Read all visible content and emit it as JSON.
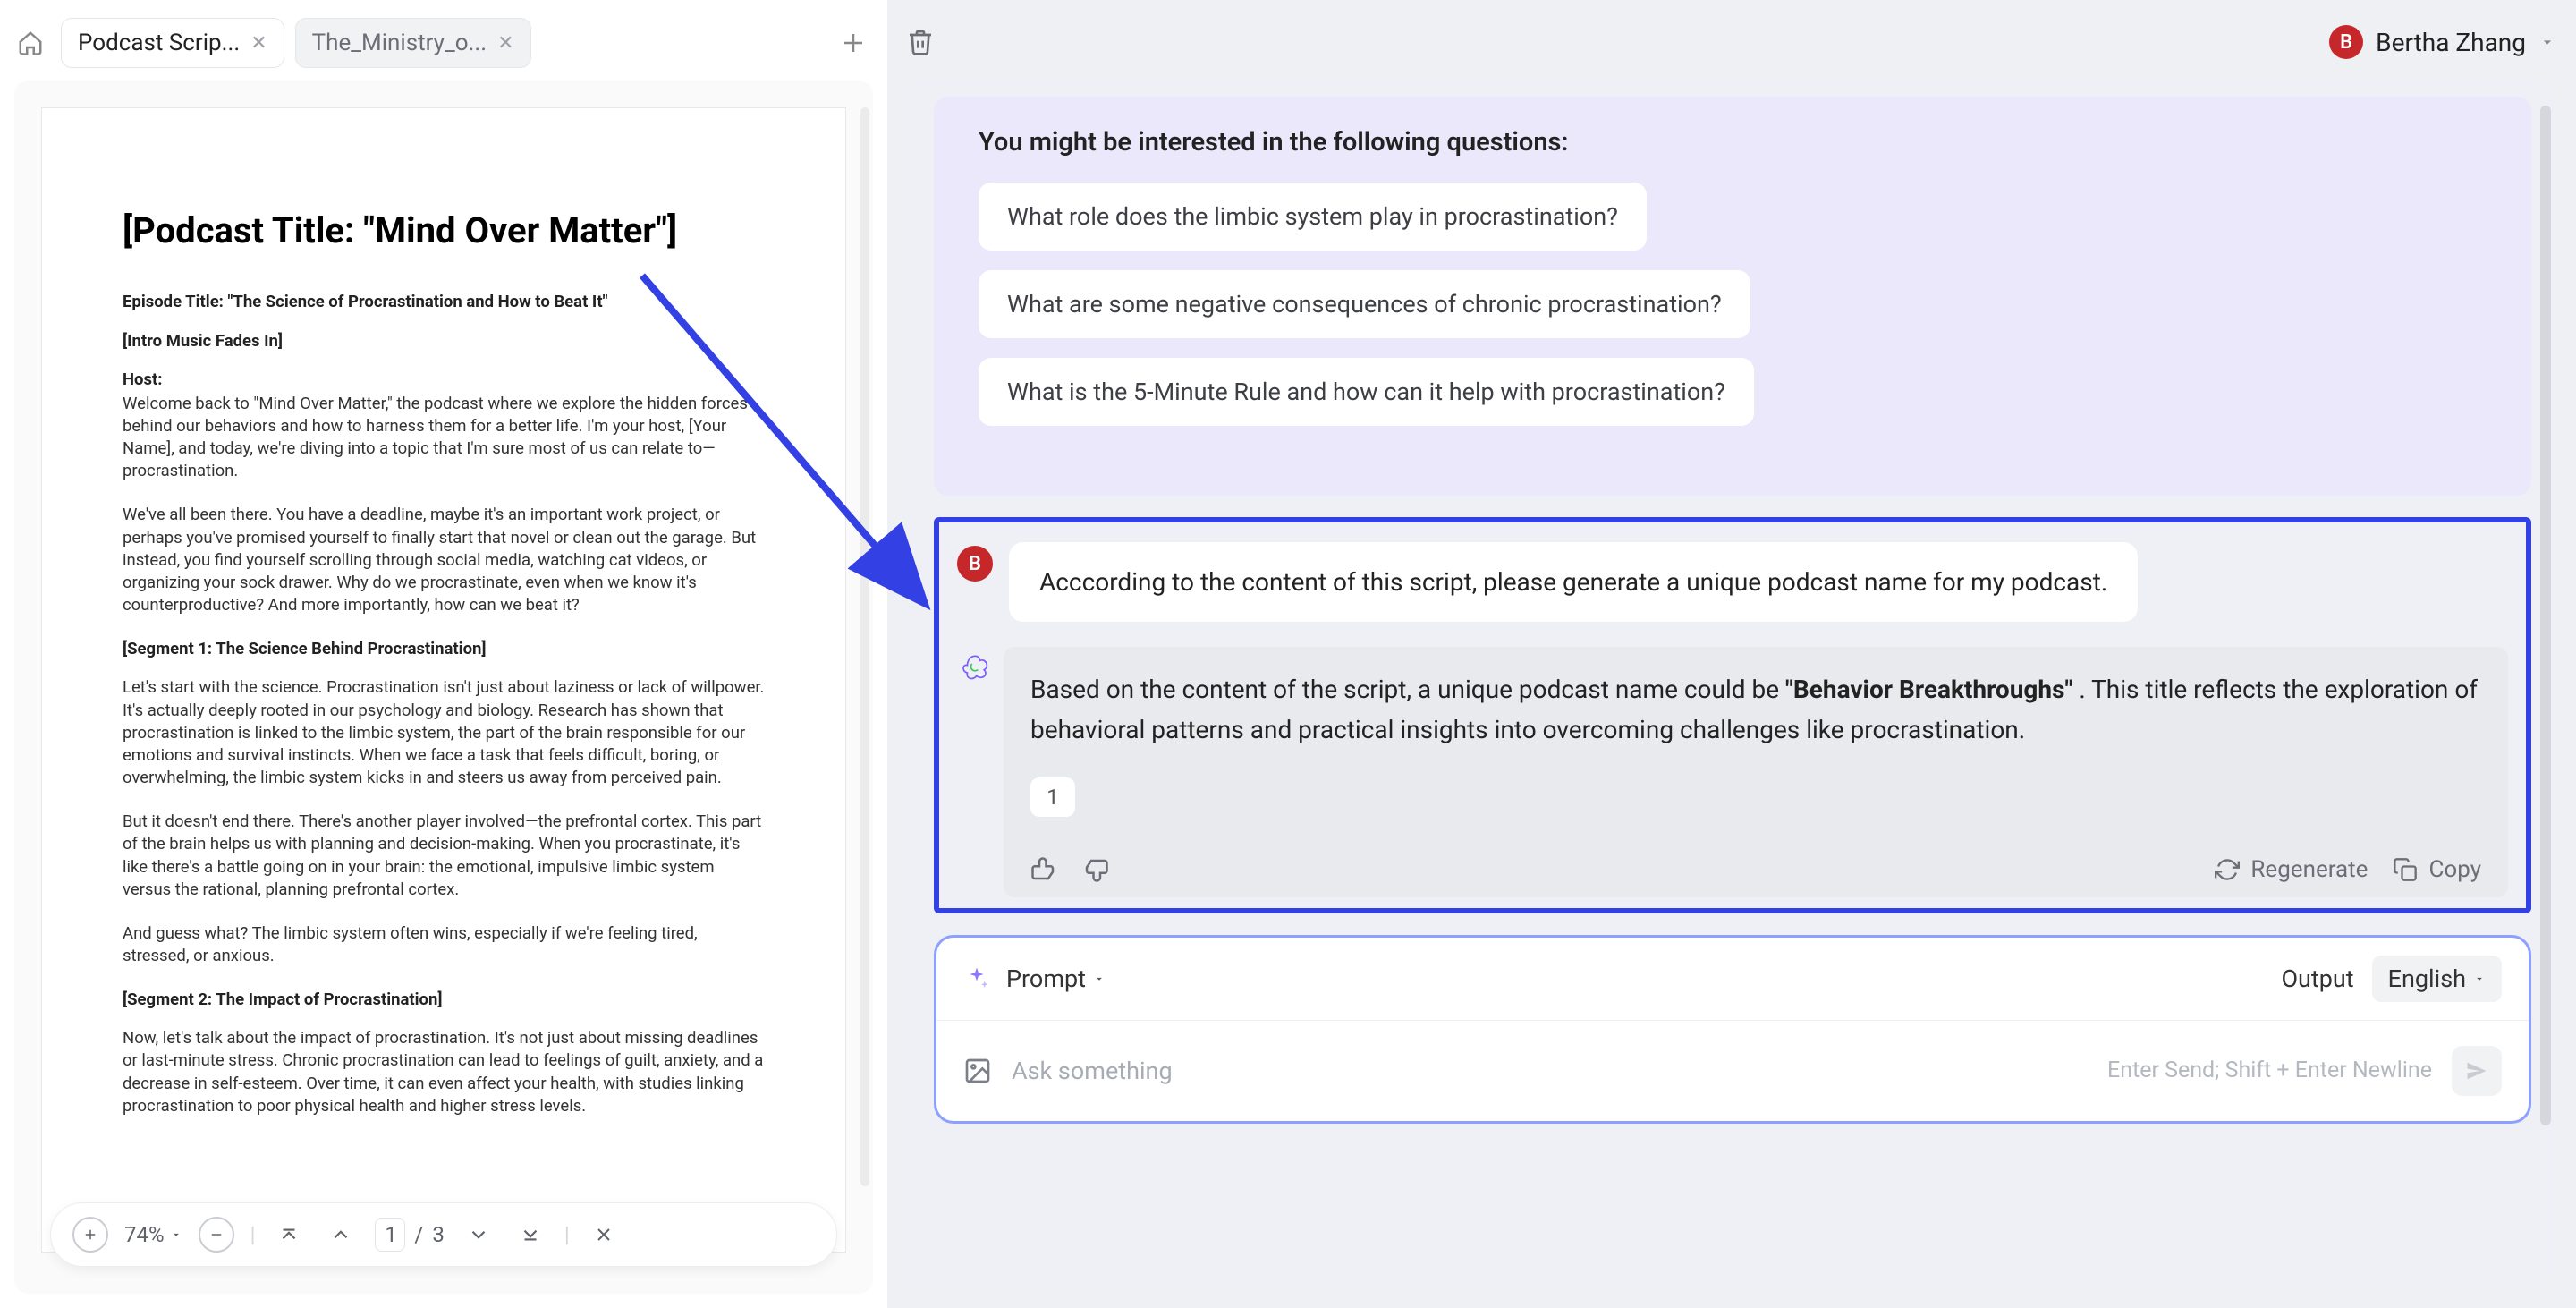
{
  "tabs": {
    "active": "Podcast Scrip...",
    "inactive": "The_Ministry_o..."
  },
  "user": {
    "initial": "B",
    "name": "Bertha Zhang"
  },
  "document": {
    "title": "[Podcast Title: \"Mind Over Matter\"]",
    "episode_title": "Episode Title: \"The Science of Procrastination and How to Beat It\"",
    "intro_label": "[Intro Music Fades In]",
    "host_label": "Host:",
    "p1": "Welcome back to \"Mind Over Matter,\" the podcast where we explore the hidden forces behind our behaviors and how to harness them for a better life. I'm your host, [Your Name], and today, we're diving into a topic that I'm sure most of us can relate to—procrastination.",
    "p2": "We've all been there. You have a deadline, maybe it's an important work project, or perhaps you've promised yourself to finally start that novel or clean out the garage. But instead, you find yourself scrolling through social media, watching cat videos, or organizing your sock drawer. Why do we procrastinate, even when we know it's counterproductive? And more importantly, how can we beat it?",
    "seg1_label": "[Segment 1: The Science Behind Procrastination]",
    "p3": "Let's start with the science. Procrastination isn't just about laziness or lack of willpower. It's actually deeply rooted in our psychology and biology. Research has shown that procrastination is linked to the limbic system, the part of the brain responsible for our emotions and survival instincts. When we face a task that feels difficult, boring, or overwhelming, the limbic system kicks in and steers us away from perceived pain.",
    "p4": "But it doesn't end there. There's another player involved—the prefrontal cortex. This part of the brain helps us with planning and decision-making. When you procrastinate, it's like there's a battle going on in your brain: the emotional, impulsive limbic system versus the rational, planning prefrontal cortex.",
    "p5": "And guess what? The limbic system often wins, especially if we're feeling tired, stressed, or anxious.",
    "seg2_label": "[Segment 2: The Impact of Procrastination]",
    "p6": "Now, let's talk about the impact of procrastination. It's not just about missing deadlines or last-minute stress. Chronic procrastination can lead to feelings of guilt, anxiety, and a decrease in self-esteem. Over time, it can even affect your health, with studies linking procrastination to poor physical health and higher stress levels."
  },
  "toolbar": {
    "zoom": "74%",
    "page_current": "1",
    "page_sep": "/",
    "page_total": "3"
  },
  "suggestions": {
    "title": "You might be interested in the following questions:",
    "q1": "What role does the limbic system play in procrastination?",
    "q2": "What are some negative consequences of chronic procrastination?",
    "q3": "What is the 5-Minute Rule and how can it help with procrastination?"
  },
  "chat": {
    "user_msg": "Acccording to the content of this script, please generate a unique podcast name for my podcast.",
    "ai_pre": "Based on the content of the script, a unique podcast name could be ",
    "ai_bold": "\"Behavior Breakthroughs\"",
    "ai_post": " . This title reflects the exploration of behavioral patterns and practical insights into overcoming challenges like procrastination.",
    "variant": "1",
    "regenerate": "Regenerate",
    "copy": "Copy"
  },
  "prompt": {
    "label": "Prompt",
    "output": "Output",
    "lang": "English",
    "placeholder": "Ask something",
    "hint": "Enter Send; Shift + Enter Newline"
  }
}
